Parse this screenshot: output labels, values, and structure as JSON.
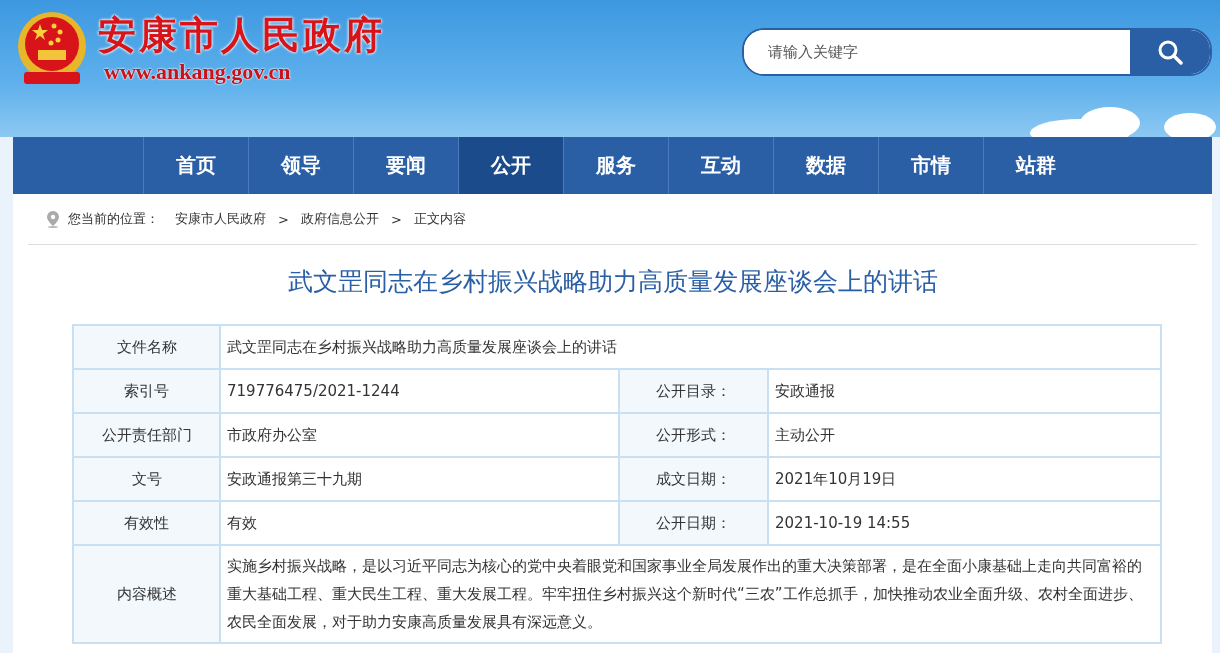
{
  "header": {
    "title": "安康市人民政府",
    "url": "www.ankang.gov.cn",
    "search": {
      "placeholder": "请输入关键字"
    }
  },
  "nav": [
    {
      "label": "首页",
      "selected": false
    },
    {
      "label": "领导",
      "selected": false
    },
    {
      "label": "要闻",
      "selected": false
    },
    {
      "label": "公开",
      "selected": true
    },
    {
      "label": "服务",
      "selected": false
    },
    {
      "label": "互动",
      "selected": false
    },
    {
      "label": "数据",
      "selected": false
    },
    {
      "label": "市情",
      "selected": false
    },
    {
      "label": "站群",
      "selected": false
    }
  ],
  "breadcrumb": {
    "prefix": "您当前的位置：",
    "items": [
      {
        "kind": "link",
        "label": "安康市人民政府"
      },
      {
        "kind": "sep",
        "label": ">"
      },
      {
        "kind": "link",
        "label": "政府信息公开"
      },
      {
        "kind": "sep",
        "label": ">"
      },
      {
        "kind": "link",
        "label": "正文内容"
      }
    ]
  },
  "article_title": "武文罡同志在乡村振兴战略助力高质量发展座谈会上的讲话",
  "table": [
    {
      "cells": [
        {
          "label": "文件名称",
          "value": "武文罡同志在乡村振兴战略助力高质量发展座谈会上的讲话"
        }
      ]
    },
    {
      "cells": [
        {
          "label": "索引号",
          "value": "719776475/2021-1244"
        },
        {
          "label": "公开目录：",
          "value": "安政通报"
        }
      ]
    },
    {
      "cells": [
        {
          "label": "公开责任部门",
          "value": "市政府办公室"
        },
        {
          "label": "公开形式：",
          "value": "主动公开"
        }
      ]
    },
    {
      "cells": [
        {
          "label": "文号",
          "value": "安政通报第三十九期"
        },
        {
          "label": "成文日期：",
          "value": "2021年10月19日"
        }
      ]
    },
    {
      "cells": [
        {
          "label": "有效性",
          "value": "有效"
        },
        {
          "label": "公开日期：",
          "value": "2021-10-19 14:55"
        }
      ]
    },
    {
      "cells": [
        {
          "label": "内容概述",
          "value": "实施乡村振兴战略，是以习近平同志为核心的党中央着眼党和国家事业全局发展作出的重大决策部署，是在全面小康基础上走向共同富裕的重大基础工程、重大民生工程、重大发展工程。牢牢扭住乡村振兴这个新时代“三农”工作总抓手，加快推动农业全面升级、农村全面进步、农民全面发展，对于助力安康高质量发展具有深远意义。"
        }
      ]
    }
  ]
}
